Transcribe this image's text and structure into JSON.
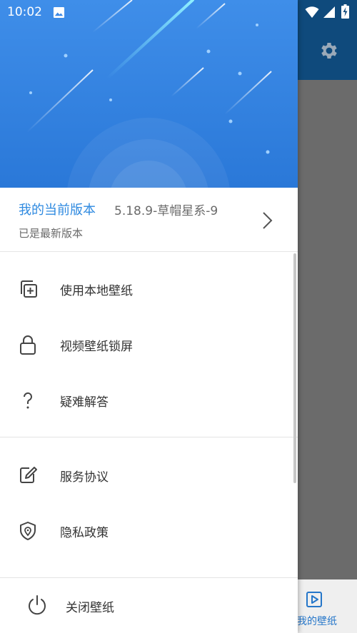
{
  "status_bar": {
    "time": "10:02"
  },
  "version": {
    "title": "我的当前版本",
    "number": "5.18.9-草帽星系-9",
    "status": "已是最新版本"
  },
  "menu": {
    "group1": [
      {
        "label": "使用本地壁纸",
        "icon": "add-local-wallpaper-icon"
      },
      {
        "label": "视频壁纸锁屏",
        "icon": "lock-icon"
      },
      {
        "label": "疑难解答",
        "icon": "question-icon"
      }
    ],
    "group2": [
      {
        "label": "服务协议",
        "icon": "edit-document-icon"
      },
      {
        "label": "隐私政策",
        "icon": "shield-location-icon"
      }
    ]
  },
  "footer": {
    "label": "关闭壁纸",
    "icon": "power-icon"
  },
  "background_app": {
    "nav_label": "我的壁纸"
  },
  "colors": {
    "accent": "#2f8ae0",
    "header_top": "#3f8ee9",
    "header_bottom": "#2b7ad8",
    "bg_header": "#0f4a7c"
  }
}
